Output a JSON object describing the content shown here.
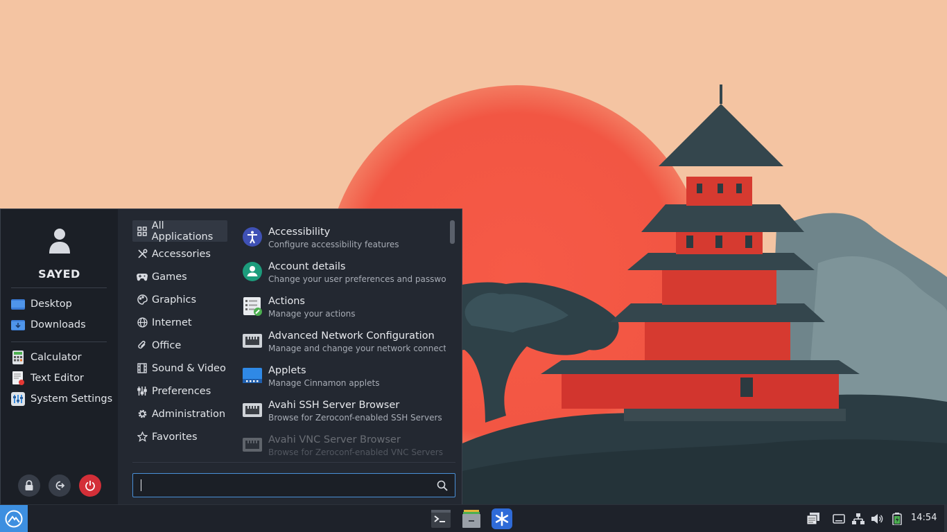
{
  "user": {
    "name": "SAYED"
  },
  "places": [
    {
      "label": "Desktop",
      "icon": "desktop-folder-icon"
    },
    {
      "label": "Downloads",
      "icon": "downloads-folder-icon"
    }
  ],
  "favorites": [
    {
      "label": "Calculator",
      "icon": "calculator-icon"
    },
    {
      "label": "Text Editor",
      "icon": "text-editor-icon"
    },
    {
      "label": "System Settings",
      "icon": "system-settings-icon"
    }
  ],
  "session": {
    "lock": "lock-icon",
    "logout": "logout-icon",
    "power": "power-icon"
  },
  "categories": [
    {
      "label": "All Applications",
      "icon": "grid-icon",
      "active": true
    },
    {
      "label": "Accessories",
      "icon": "tools-icon"
    },
    {
      "label": "Games",
      "icon": "gamepad-icon"
    },
    {
      "label": "Graphics",
      "icon": "palette-icon"
    },
    {
      "label": "Internet",
      "icon": "globe-icon"
    },
    {
      "label": "Office",
      "icon": "paperclip-icon"
    },
    {
      "label": "Sound & Video",
      "icon": "film-icon"
    },
    {
      "label": "Preferences",
      "icon": "sliders-icon"
    },
    {
      "label": "Administration",
      "icon": "cog-icon"
    },
    {
      "label": "Favorites",
      "icon": "star-icon"
    }
  ],
  "apps": [
    {
      "name": "Accessibility",
      "desc": "Configure accessibility features",
      "icon": "accessibility-icon"
    },
    {
      "name": "Account details",
      "desc": "Change your user preferences and password",
      "icon": "account-icon"
    },
    {
      "name": "Actions",
      "desc": "Manage your actions",
      "icon": "actions-icon"
    },
    {
      "name": "Advanced Network Configuration",
      "desc": "Manage and change your network connecti...",
      "icon": "network-icon"
    },
    {
      "name": "Applets",
      "desc": "Manage Cinnamon applets",
      "icon": "applets-icon"
    },
    {
      "name": "Avahi SSH Server Browser",
      "desc": "Browse for Zeroconf-enabled SSH Servers",
      "icon": "network-icon"
    },
    {
      "name": "Avahi VNC Server Browser",
      "desc": "Browse for Zeroconf-enabled VNC Servers",
      "icon": "network-icon"
    }
  ],
  "search": {
    "value": "",
    "placeholder": ""
  },
  "taskbar": {
    "launchers": [
      "terminal-icon",
      "file-manager-icon",
      "app-launcher-icon"
    ],
    "tray": [
      "notifications-icon",
      "display-icon",
      "network-tray-icon",
      "volume-icon",
      "battery-icon"
    ],
    "clock": "14:54"
  },
  "colors": {
    "accent": "#3d8fe0",
    "power": "#d32f38",
    "menu_bg": "#232831",
    "panel_bg": "#1e222a"
  }
}
